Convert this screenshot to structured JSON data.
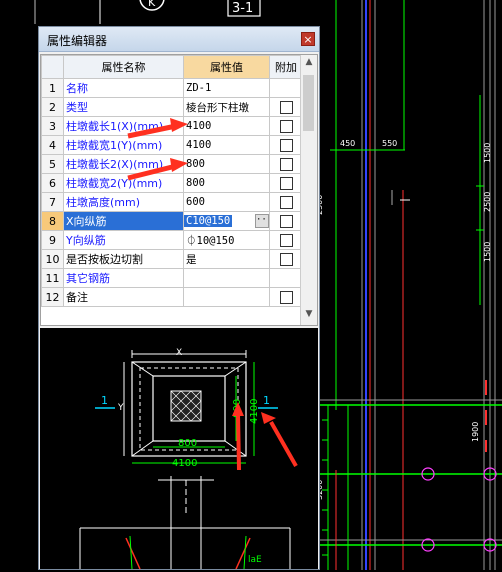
{
  "cad": {
    "labels": {
      "dim_450": "450",
      "dim_550": "550",
      "v_1500_top": "1500",
      "v_2500": "2500",
      "v_1500_mid": "1500",
      "v_1900": "1900",
      "v_3200": "3200",
      "v_2500_left": "2500",
      "tag_k": "K",
      "tag_3": "3-1"
    }
  },
  "dialog": {
    "title": "属性编辑器",
    "close_label": "×",
    "headers": {
      "name": "属性名称",
      "value": "属性值",
      "extra": "附加"
    },
    "rows": [
      {
        "num": "1",
        "name": "名称",
        "value": "ZD-1",
        "checkbox": false
      },
      {
        "num": "2",
        "name": "类型",
        "value": "棱台形下柱墩",
        "checkbox": true
      },
      {
        "num": "3",
        "name": "柱墩截长1(X)(mm)",
        "value": "4100",
        "checkbox": true
      },
      {
        "num": "4",
        "name": "柱墩截宽1(Y)(mm)",
        "value": "4100",
        "checkbox": true
      },
      {
        "num": "5",
        "name": "柱墩截长2(X)(mm)",
        "value": "800",
        "checkbox": true
      },
      {
        "num": "6",
        "name": "柱墩截宽2(Y)(mm)",
        "value": "800",
        "checkbox": true
      },
      {
        "num": "7",
        "name": "柱墩高度(mm)",
        "value": "600",
        "checkbox": true
      },
      {
        "num": "8",
        "name": "X向纵筋",
        "value": "C10@150",
        "checkbox": true
      },
      {
        "num": "9",
        "name": "Y向纵筋",
        "value": "⏀10@150",
        "checkbox": true
      },
      {
        "num": "10",
        "name": "是否按板边切割",
        "value": "是",
        "checkbox": true
      },
      {
        "num": "11",
        "name": "其它钢筋",
        "value": "",
        "checkbox": false
      },
      {
        "num": "12",
        "name": "备注",
        "value": "",
        "checkbox": true
      }
    ],
    "preview": {
      "x_label": "X",
      "y_label": "Y",
      "dim_inner": "800",
      "dim_outer": "4100",
      "dim_inner_v": "800",
      "dim_outer_v": "4100",
      "section_left": "1",
      "section_right": "1",
      "lae": "laE"
    }
  },
  "colors": {
    "cad_green": "#00ff00",
    "cad_red_arrow": "#ff3020",
    "cad_cyan": "#00d8ff",
    "cad_magenta": "#ff40ff",
    "cad_blue_line": "#3344ff",
    "selection": "#2a6fd6",
    "value_header": "#f8d9a0"
  }
}
